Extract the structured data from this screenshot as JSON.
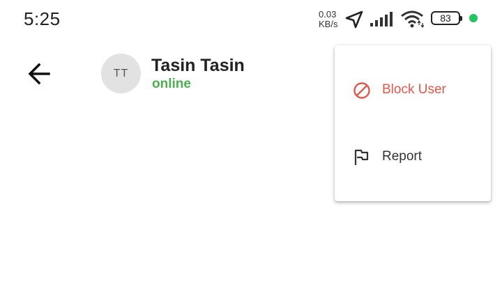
{
  "status_bar": {
    "time": "5:25",
    "speed_value": "0.03",
    "speed_unit": "KB/s",
    "battery": "83",
    "icons": [
      "location-arrow-icon",
      "signal-icon",
      "wifi-icon",
      "battery-icon"
    ],
    "dot_color": "#22c55e"
  },
  "header": {
    "back_icon": "arrow-left-icon",
    "avatar_initials": "TT",
    "name": "Tasin Tasin",
    "status": "online",
    "status_color": "#4caf50"
  },
  "menu": {
    "items": [
      {
        "label": "Block User",
        "icon": "block-icon",
        "color": "#e0574b"
      },
      {
        "label": "Report",
        "icon": "flag-icon",
        "color": "#333333"
      }
    ]
  }
}
